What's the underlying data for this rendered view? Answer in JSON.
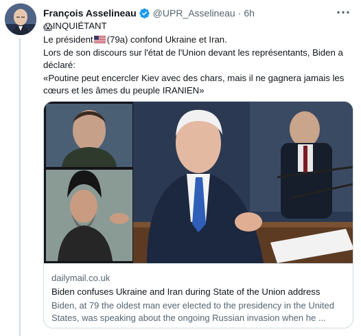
{
  "tweet": {
    "author_name": "François Asselineau",
    "handle": "@UPR_Asselineau",
    "separator": "·",
    "time": "6h",
    "more_label": "•••",
    "lines": [
      "INQUIÉTANT",
      "(79a) confond Ukraine et Iran.",
      "Lors de son discours sur l'état de l'Union devant les représentants, Biden a",
      "déclaré:",
      "«Poutine peut encercler Kiev avec des chars, mais il ne gagnera jamais les",
      "cœurs et les âmes du peuple IRANIEN»"
    ],
    "line_prefix": "Le président",
    "scream_emoji": "😱",
    "flag": "US flag"
  },
  "card": {
    "domain": "dailymail.co.uk",
    "title": "Biden confuses Ukraine and Iran during State of the Union address",
    "description_line1": "Biden, at 79 the oldest man ever elected to the presidency in the United",
    "description_line2": "States, was speaking about the ongoing Russian invasion when he ..."
  },
  "colors": {
    "text_primary": "#0f1419",
    "text_secondary": "#536471",
    "verified_blue": "#1d9bf0",
    "border": "#cfd9de"
  },
  "icons": [
    "avatar",
    "verified-badge-icon",
    "more-options-icon",
    "face-screaming-emoji",
    "us-flag-icon"
  ]
}
